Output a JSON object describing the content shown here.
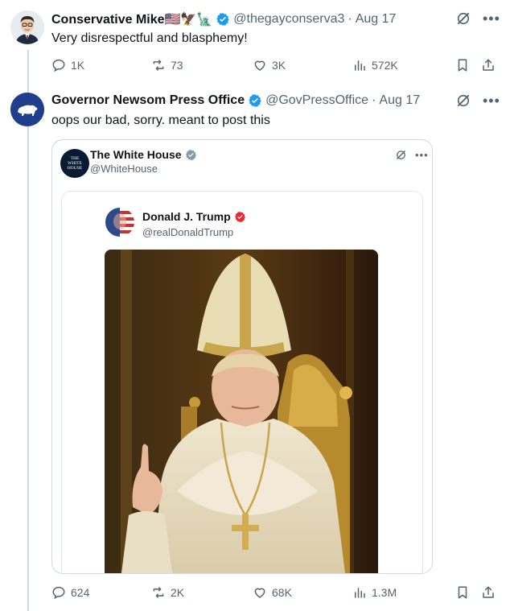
{
  "tweet1": {
    "name": "Conservative Mike🇺🇸🦅🗽",
    "handle": "@thegayconserva3",
    "date": "Aug 17",
    "text": "Very disrespectful and blasphemy!",
    "replies": "1K",
    "retweets": "73",
    "likes": "3K",
    "views": "572K"
  },
  "tweet2": {
    "name": "Governor Newsom Press Office",
    "handle": "@GovPressOffice",
    "date": "Aug 17",
    "text": "oops our bad, sorry. meant to post this",
    "replies": "624",
    "retweets": "2K",
    "likes": "68K",
    "views": "1.3M"
  },
  "quote": {
    "name": "The White House",
    "handle": "@WhiteHouse",
    "avatar_text": "THE WHITE HOUSE"
  },
  "inner_quote": {
    "name": "Donald J. Trump",
    "handle": "@realDonaldTrump"
  },
  "separator": "·",
  "colors": {
    "verified_blue": "#1d9bf0",
    "verified_red": "#f4212e",
    "muted": "#536471",
    "newsom_avatar": "#1f3f8c"
  }
}
